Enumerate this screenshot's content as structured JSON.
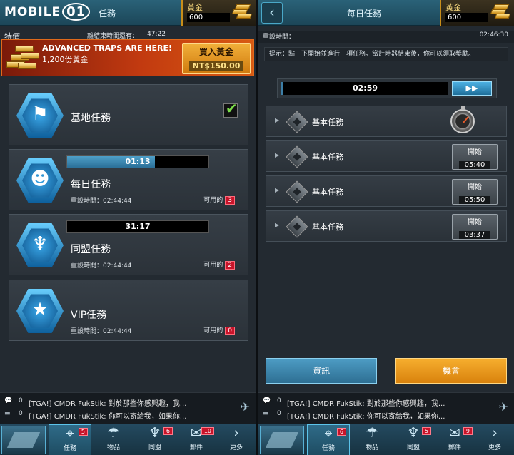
{
  "left": {
    "logo": "MOBILE01",
    "logo_suffix": "01",
    "title": "任務",
    "gold": {
      "label": "黃金",
      "value": "600"
    },
    "offer": {
      "label": "特價",
      "timer_label": "離結束時間還有：",
      "timer": "47:22",
      "headline": "ADVANCED TRAPS ARE HERE!",
      "sub": "1,200份黃金",
      "buy_label": "買入黃金",
      "price": "NT$150.00"
    },
    "cards": [
      {
        "title": "基地任務",
        "icon": "flag-emblem-icon",
        "completed": true
      },
      {
        "title": "每日任務",
        "icon": "soldier-emblem-icon",
        "timer": "01:13",
        "progress": 0.62,
        "reset_label": "重設時間：",
        "reset": "02:44:44",
        "avail_label": "可用的",
        "count": "3"
      },
      {
        "title": "同盟任務",
        "icon": "eagle-emblem-icon",
        "timer": "31:17",
        "progress": 0,
        "reset_label": "重設時間：",
        "reset": "02:44:44",
        "avail_label": "可用的",
        "count": "2"
      },
      {
        "title": "VIP任務",
        "icon": "star-emblem-icon",
        "reset_label": "重設時間：",
        "reset": "02:44:44",
        "avail_label": "可用的",
        "count": "0"
      }
    ],
    "chat": [
      {
        "count": "0",
        "text": "[TGA!] CMDR FukStik: 對於那些你感興趣，我..."
      },
      {
        "count": "0",
        "text": "[TGA!] CMDR FukStik: 你可以寄給我，如果你..."
      }
    ],
    "nav": [
      {
        "label": "",
        "icon": "base-icon"
      },
      {
        "label": "任務",
        "icon": "crosshair-icon",
        "badge": "5"
      },
      {
        "label": "物品",
        "icon": "parachute-icon"
      },
      {
        "label": "同盟",
        "icon": "eagle-icon",
        "badge": "6"
      },
      {
        "label": "郵件",
        "icon": "mail-icon",
        "badge": "10"
      },
      {
        "label": "更多",
        "icon": "chevron-right-icon"
      }
    ]
  },
  "right": {
    "title": "每日任務",
    "back_icon": "back-arrow-icon",
    "gold": {
      "label": "黃金",
      "value": "600"
    },
    "reset_label": "重設時間：",
    "reset": "02:46:30",
    "hint": "提示：點一下開始並進行一項任務。當計時器結束後，你可以領取獎勵。",
    "big_timer": "02:59",
    "skip_icon": "fast-forward-icon",
    "missions": [
      {
        "name": "基本任務",
        "state": "running",
        "icon": "stopwatch-icon"
      },
      {
        "name": "基本任務",
        "start_label": "開始",
        "time": "05:40"
      },
      {
        "name": "基本任務",
        "start_label": "開始",
        "time": "05:50"
      },
      {
        "name": "基本任務",
        "start_label": "開始",
        "time": "03:37"
      }
    ],
    "info_button": "資訊",
    "chance_button": "機會",
    "chat": [
      {
        "count": "0",
        "text": "[TGA!] CMDR FukStik: 對於那些你感興趣，我..."
      },
      {
        "count": "0",
        "text": "[TGA!] CMDR FukStik: 你可以寄給我，如果你..."
      }
    ],
    "nav": [
      {
        "label": "",
        "icon": "base-icon"
      },
      {
        "label": "任務",
        "icon": "crosshair-icon",
        "badge": "6"
      },
      {
        "label": "物品",
        "icon": "parachute-icon"
      },
      {
        "label": "同盟",
        "icon": "eagle-icon",
        "badge": "5"
      },
      {
        "label": "郵件",
        "icon": "mail-icon",
        "badge": "9"
      },
      {
        "label": "更多",
        "icon": "chevron-right-icon"
      }
    ]
  },
  "colors": {
    "accent": "#2a6278",
    "gold": "#c98e1a",
    "orange": "#f0a020",
    "badge": "#c8142a"
  }
}
